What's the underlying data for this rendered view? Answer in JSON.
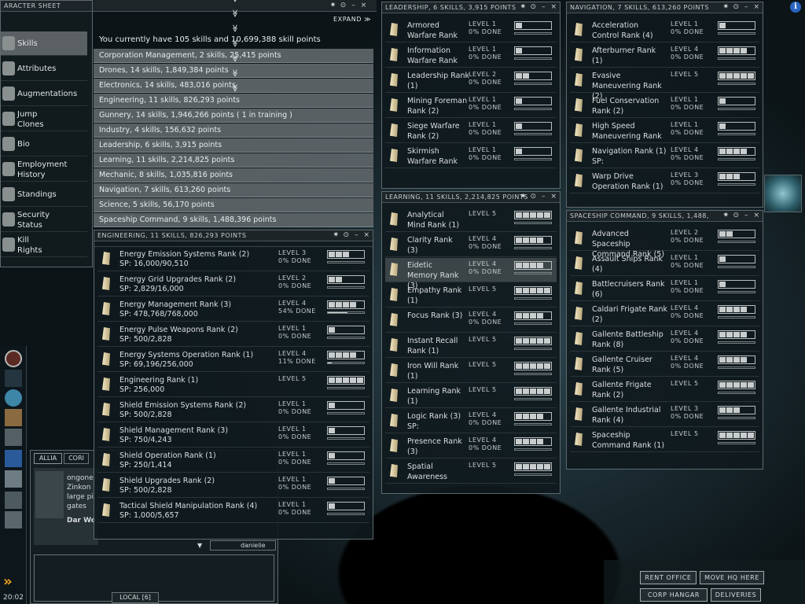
{
  "character_sheet": {
    "title": "ARACTER SHEET",
    "expand": "EXPAND",
    "summary": "You currently have 105 skills and 10,699,388 skill points"
  },
  "nav": [
    {
      "label": "Skills",
      "icon": "skills-icon"
    },
    {
      "label": "Attributes",
      "icon": "attributes-icon"
    },
    {
      "label": "Augmentations",
      "icon": "augmentations-icon"
    },
    {
      "label": "Jump\nClones",
      "icon": "jump-clones-icon"
    },
    {
      "label": "Bio",
      "icon": "bio-icon"
    },
    {
      "label": "Employment\nHistory",
      "icon": "employment-icon"
    },
    {
      "label": "Standings",
      "icon": "standings-icon"
    },
    {
      "label": "Security\nStatus",
      "icon": "security-icon"
    },
    {
      "label": "Kill\nRights",
      "icon": "kill-rights-icon"
    }
  ],
  "groups": [
    "Corporation Management, 2 skills, 25,415 points",
    "Drones, 14 skills, 1,849,384 points",
    "Electronics, 14 skills, 483,016 points",
    "Engineering, 11 skills, 826,293 points",
    "Gunnery, 14 skills, 1,946,266 points ( 1 in training )",
    "Industry, 4 skills, 156,632 points",
    "Leadership, 6 skills, 3,915 points",
    "Learning, 11 skills, 2,214,825 points",
    "Mechanic, 8 skills, 1,035,816 points",
    "Navigation, 7 skills, 613,260 points",
    "Science, 5 skills, 56,170 points",
    "Spaceship Command, 9 skills, 1,488,396 points"
  ],
  "engineering": {
    "title": "ENGINEERING, 11 SKILLS, 826,293 POINTS",
    "skills": [
      {
        "name": "Energy Emission Systems Rank (2)",
        "sp": "SP: 16,000/90,510",
        "level": "LEVEL 3",
        "done": "0% DONE",
        "filled": 3
      },
      {
        "name": "Energy Grid Upgrades Rank (2)",
        "sp": "SP: 2,829/16,000",
        "level": "LEVEL 2",
        "done": "0% DONE",
        "filled": 2
      },
      {
        "name": "Energy Management Rank (3)",
        "sp": "SP: 478,768/768,000",
        "level": "LEVEL 4",
        "done": "54% DONE",
        "filled": 4,
        "progress": 0.54
      },
      {
        "name": "Energy Pulse Weapons Rank (2)",
        "sp": "SP: 500/2,828",
        "level": "LEVEL 1",
        "done": "0% DONE",
        "filled": 1
      },
      {
        "name": "Energy Systems Operation Rank (1)",
        "sp": "SP: 69,196/256,000",
        "level": "LEVEL 4",
        "done": "11% DONE",
        "filled": 4,
        "progress": 0.11
      },
      {
        "name": "Engineering Rank (1)",
        "sp": "SP: 256,000",
        "level": "LEVEL 5",
        "done": "",
        "filled": 5
      },
      {
        "name": "Shield Emission Systems Rank (2)",
        "sp": "SP: 500/2,828",
        "level": "LEVEL 1",
        "done": "0% DONE",
        "filled": 1
      },
      {
        "name": "Shield Management Rank (3)",
        "sp": "SP: 750/4,243",
        "level": "LEVEL 1",
        "done": "0% DONE",
        "filled": 1
      },
      {
        "name": "Shield Operation Rank (1)",
        "sp": "SP: 250/1,414",
        "level": "LEVEL 1",
        "done": "0% DONE",
        "filled": 1
      },
      {
        "name": "Shield Upgrades Rank (2)",
        "sp": "SP: 500/2,828",
        "level": "LEVEL 1",
        "done": "0% DONE",
        "filled": 1
      },
      {
        "name": "Tactical Shield Manipulation Rank (4)",
        "sp": "SP: 1,000/5,657",
        "level": "LEVEL 1",
        "done": "0% DONE",
        "filled": 1
      }
    ]
  },
  "leadership": {
    "title": "LEADERSHIP, 6 SKILLS, 3,915 POINTS",
    "skills": [
      {
        "name": "Armored Warfare Rank",
        "level": "LEVEL 1",
        "done": "0% DONE",
        "filled": 1
      },
      {
        "name": "Information Warfare Rank",
        "level": "LEVEL 1",
        "done": "0% DONE",
        "filled": 1
      },
      {
        "name": "Leadership Rank (1)",
        "level": "LEVEL 2",
        "done": "0% DONE",
        "filled": 2
      },
      {
        "name": "Mining Foreman Rank (2)",
        "level": "LEVEL 1",
        "done": "0% DONE",
        "filled": 1
      },
      {
        "name": "Siege Warfare Rank (2)",
        "level": "LEVEL 1",
        "done": "0% DONE",
        "filled": 1
      },
      {
        "name": "Skirmish Warfare Rank",
        "level": "LEVEL 1",
        "done": "0% DONE",
        "filled": 1
      }
    ]
  },
  "learning": {
    "title": "LEARNING, 11 SKILLS, 2,214,825 POINTS",
    "skills": [
      {
        "name": "Analytical Mind Rank (1)",
        "level": "LEVEL 5",
        "done": "",
        "filled": 5
      },
      {
        "name": "Clarity Rank (3)",
        "level": "LEVEL 4",
        "done": "0% DONE",
        "filled": 4
      },
      {
        "name": "Eidetic Memory Rank (3)",
        "level": "LEVEL 4",
        "done": "0% DONE",
        "filled": 4,
        "selected": true
      },
      {
        "name": "Empathy Rank (1)",
        "level": "LEVEL 5",
        "done": "",
        "filled": 5
      },
      {
        "name": "Focus Rank (3)",
        "level": "LEVEL 4",
        "done": "0% DONE",
        "filled": 4
      },
      {
        "name": "Instant Recall Rank (1)",
        "level": "LEVEL 5",
        "done": "",
        "filled": 5
      },
      {
        "name": "Iron Will Rank (1)",
        "level": "LEVEL 5",
        "done": "",
        "filled": 5
      },
      {
        "name": "Learning Rank (1)",
        "level": "LEVEL 5",
        "done": "",
        "filled": 5
      },
      {
        "name": "Logic Rank (3)",
        "level": "LEVEL 4",
        "done": "0% DONE",
        "filled": 4,
        "sp": "SP:"
      },
      {
        "name": "Presence Rank (3)",
        "level": "LEVEL 4",
        "done": "0% DONE",
        "filled": 4
      },
      {
        "name": "Spatial Awareness",
        "level": "LEVEL 5",
        "done": "",
        "filled": 5
      }
    ]
  },
  "navigation": {
    "title": "NAVIGATION, 7 SKILLS, 613,260 POINTS",
    "skills": [
      {
        "name": "Acceleration Control Rank (4)",
        "level": "LEVEL 1",
        "done": "0% DONE",
        "filled": 1
      },
      {
        "name": "Afterburner Rank (1)",
        "level": "LEVEL 4",
        "done": "0% DONE",
        "filled": 4
      },
      {
        "name": "Evasive Maneuvering Rank (2)",
        "level": "LEVEL 5",
        "done": "",
        "filled": 5
      },
      {
        "name": "Fuel Conservation Rank (2)",
        "level": "LEVEL 1",
        "done": "0% DONE",
        "filled": 1
      },
      {
        "name": "High Speed Maneuvering Rank",
        "level": "LEVEL 1",
        "done": "0% DONE",
        "filled": 1
      },
      {
        "name": "Navigation Rank (1)",
        "level": "LEVEL 4",
        "done": "0% DONE",
        "filled": 4,
        "sp": "SP:"
      },
      {
        "name": "Warp Drive Operation Rank (1)",
        "level": "LEVEL 3",
        "done": "0% DONE",
        "filled": 3
      }
    ]
  },
  "spaceship": {
    "title": "SPACESHIP COMMAND, 9 SKILLS, 1,488,",
    "skills": [
      {
        "name": "Advanced Spaceship Command Rank (5)",
        "level": "LEVEL 2",
        "done": "0% DONE",
        "filled": 2
      },
      {
        "name": "Assault Ships Rank (4)",
        "level": "LEVEL 1",
        "done": "0% DONE",
        "filled": 1
      },
      {
        "name": "Battlecruisers Rank (6)",
        "level": "LEVEL 1",
        "done": "0% DONE",
        "filled": 1
      },
      {
        "name": "Caldari Frigate Rank (2)",
        "level": "LEVEL 4",
        "done": "0% DONE",
        "filled": 4
      },
      {
        "name": "Gallente Battleship Rank (8)",
        "level": "LEVEL 4",
        "done": "0% DONE",
        "filled": 4
      },
      {
        "name": "Gallente Cruiser Rank (5)",
        "level": "LEVEL 4",
        "done": "0% DONE",
        "filled": 4
      },
      {
        "name": "Gallente Frigate Rank (2)",
        "level": "LEVEL 5",
        "done": "",
        "filled": 5
      },
      {
        "name": "Gallente Industrial Rank (4)",
        "level": "LEVEL 3",
        "done": "0% DONE",
        "filled": 3
      },
      {
        "name": "Spaceship Command Rank (1)",
        "level": "LEVEL 5",
        "done": "",
        "filled": 5
      }
    ]
  },
  "chat": {
    "tabs": [
      "ALLIA",
      "CORI"
    ],
    "lines": [
      "ongone",
      "Zinkon",
      "large pi",
      "gates"
    ],
    "user": "Dar Wo",
    "local": "LOCAL [6]",
    "dropdown": "danielie"
  },
  "station_buttons": [
    "RENT OFFICE",
    "MOVE HQ HERE",
    "CORP HANGAR",
    "DELIVERIES"
  ],
  "clock": "20:02",
  "window_controls": [
    "✷",
    "⊙",
    "–",
    "×"
  ],
  "info": "i"
}
